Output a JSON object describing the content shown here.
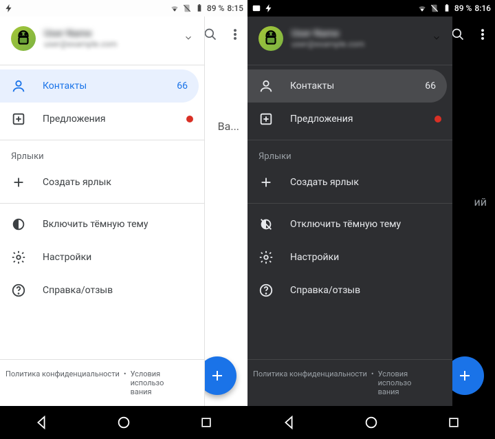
{
  "light": {
    "status": {
      "battery": "89 %",
      "time": "8:15"
    },
    "account": {
      "name": "User Name",
      "email": "user@example.com"
    },
    "items": {
      "contacts": {
        "label": "Контакты",
        "count": "66"
      },
      "suggestions": {
        "label": "Предложения"
      }
    },
    "labels_header": "Ярлыки",
    "create_label": "Создать ярлык",
    "theme_toggle": "Включить тёмную тему",
    "settings": "Настройки",
    "help": "Справка/отзыв",
    "footer": {
      "privacy": "Политика конфиденциальности",
      "terms": "Условия использования"
    },
    "body_peek": "Ва..."
  },
  "dark": {
    "status": {
      "battery": "89 %",
      "time": "8:16"
    },
    "account": {
      "name": "User Name",
      "email": "user@example.com"
    },
    "items": {
      "contacts": {
        "label": "Контакты",
        "count": "66"
      },
      "suggestions": {
        "label": "Предложения"
      }
    },
    "labels_header": "Ярлыки",
    "create_label": "Создать ярлык",
    "theme_toggle": "Отключить тёмную тему",
    "settings": "Настройки",
    "help": "Справка/отзыв",
    "footer": {
      "privacy": "Политика конфиденциальности",
      "terms": "Условия использования"
    },
    "body_peek": "ий"
  }
}
